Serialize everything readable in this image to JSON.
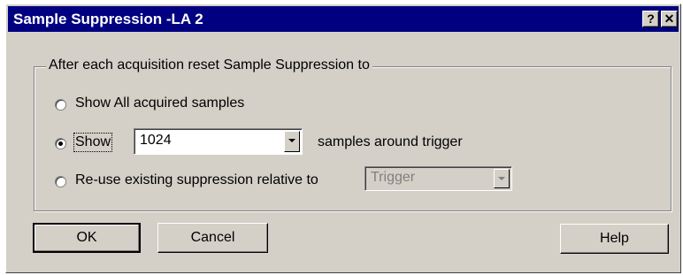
{
  "window": {
    "title": "Sample Suppression -LA 2",
    "help_glyph": "?",
    "close_glyph": "✕"
  },
  "group": {
    "legend": "After each acquisition reset Sample Suppression to"
  },
  "options": {
    "show_all": {
      "label": "Show All acquired samples",
      "checked": false
    },
    "show": {
      "label": "Show",
      "checked": true,
      "value": "1024",
      "suffix": "samples around trigger"
    },
    "reuse": {
      "label": "Re-use existing suppression relative to",
      "checked": false,
      "value": "Trigger",
      "enabled": false
    }
  },
  "buttons": {
    "ok": "OK",
    "cancel": "Cancel",
    "help": "Help"
  }
}
